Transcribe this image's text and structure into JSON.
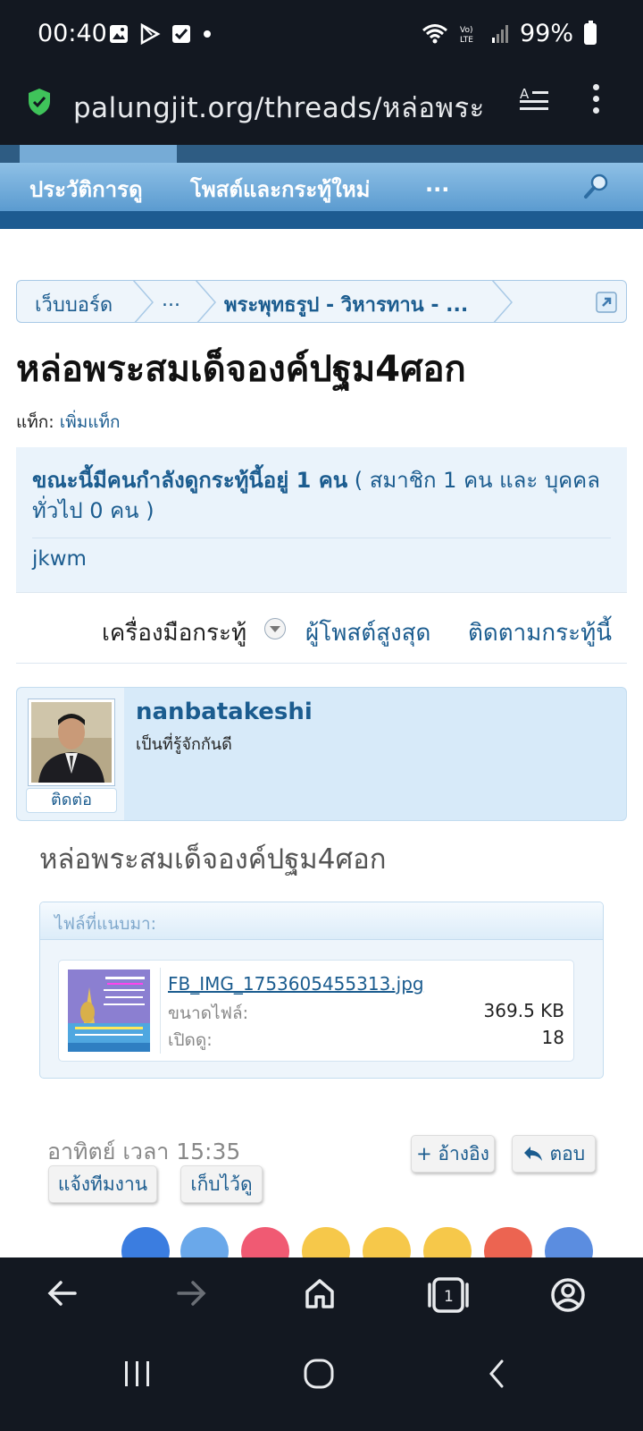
{
  "status_bar": {
    "time": "00:40",
    "battery": "99%"
  },
  "browser": {
    "url": "palungjit.org/threads/หล่อพระ"
  },
  "nav": {
    "items": [
      "ประวัติการดู",
      "โพสต์และกระทู้ใหม่",
      "..."
    ]
  },
  "breadcrumb": {
    "items": [
      "เว็บบอร์ด",
      "...",
      "พระพุทธรูป - วิหารทาน - ..."
    ]
  },
  "thread": {
    "title": "หล่อพระสมเด็จองค์ปฐม4ศอก",
    "tags_label": "แท็ก:",
    "tags_link": "เพิ่มแท็ก"
  },
  "viewing": {
    "headline": "ขณะนี้มีคนกำลังดูกระทู้นี้อยู่ 1 คน",
    "detail": " ( สมาชิก 1 คน และ บุคคลทั่วไป 0 คน )",
    "member": "jkwm"
  },
  "tools": {
    "thread_tools": "เครื่องมือกระทู้",
    "top_posters": "ผู้โพสต์สูงสุด",
    "watch_thread": "ติดตามกระทู้นี้"
  },
  "post": {
    "username": "nanbatakeshi",
    "user_title": "เป็นที่รู้จักกันดี",
    "contact": "ติดต่อ",
    "text": "หล่อพระสมเด็จองค์ปฐม4ศอก",
    "attachments_header": "ไฟล์ที่แนบมา:",
    "file": {
      "name": "FB_IMG_1753605455313.jpg",
      "size_label": "ขนาดไฟล์:",
      "size_value": "369.5 KB",
      "views_label": "เปิดดู:",
      "views_value": "18"
    },
    "date": "อาทิตย์ เวลา 15:35",
    "quote_button": "+ อ้างอิง",
    "reply_button": "ตอบ",
    "report_button": "แจ้งทีมงาน",
    "save_button": "เก็บไว้ดู"
  },
  "colors": {
    "link": "#1b5c8f",
    "nav_gradient_top": "#8ec0e6",
    "nav_gradient_bottom": "#5b9bd0",
    "browser_chrome": "#131821"
  }
}
